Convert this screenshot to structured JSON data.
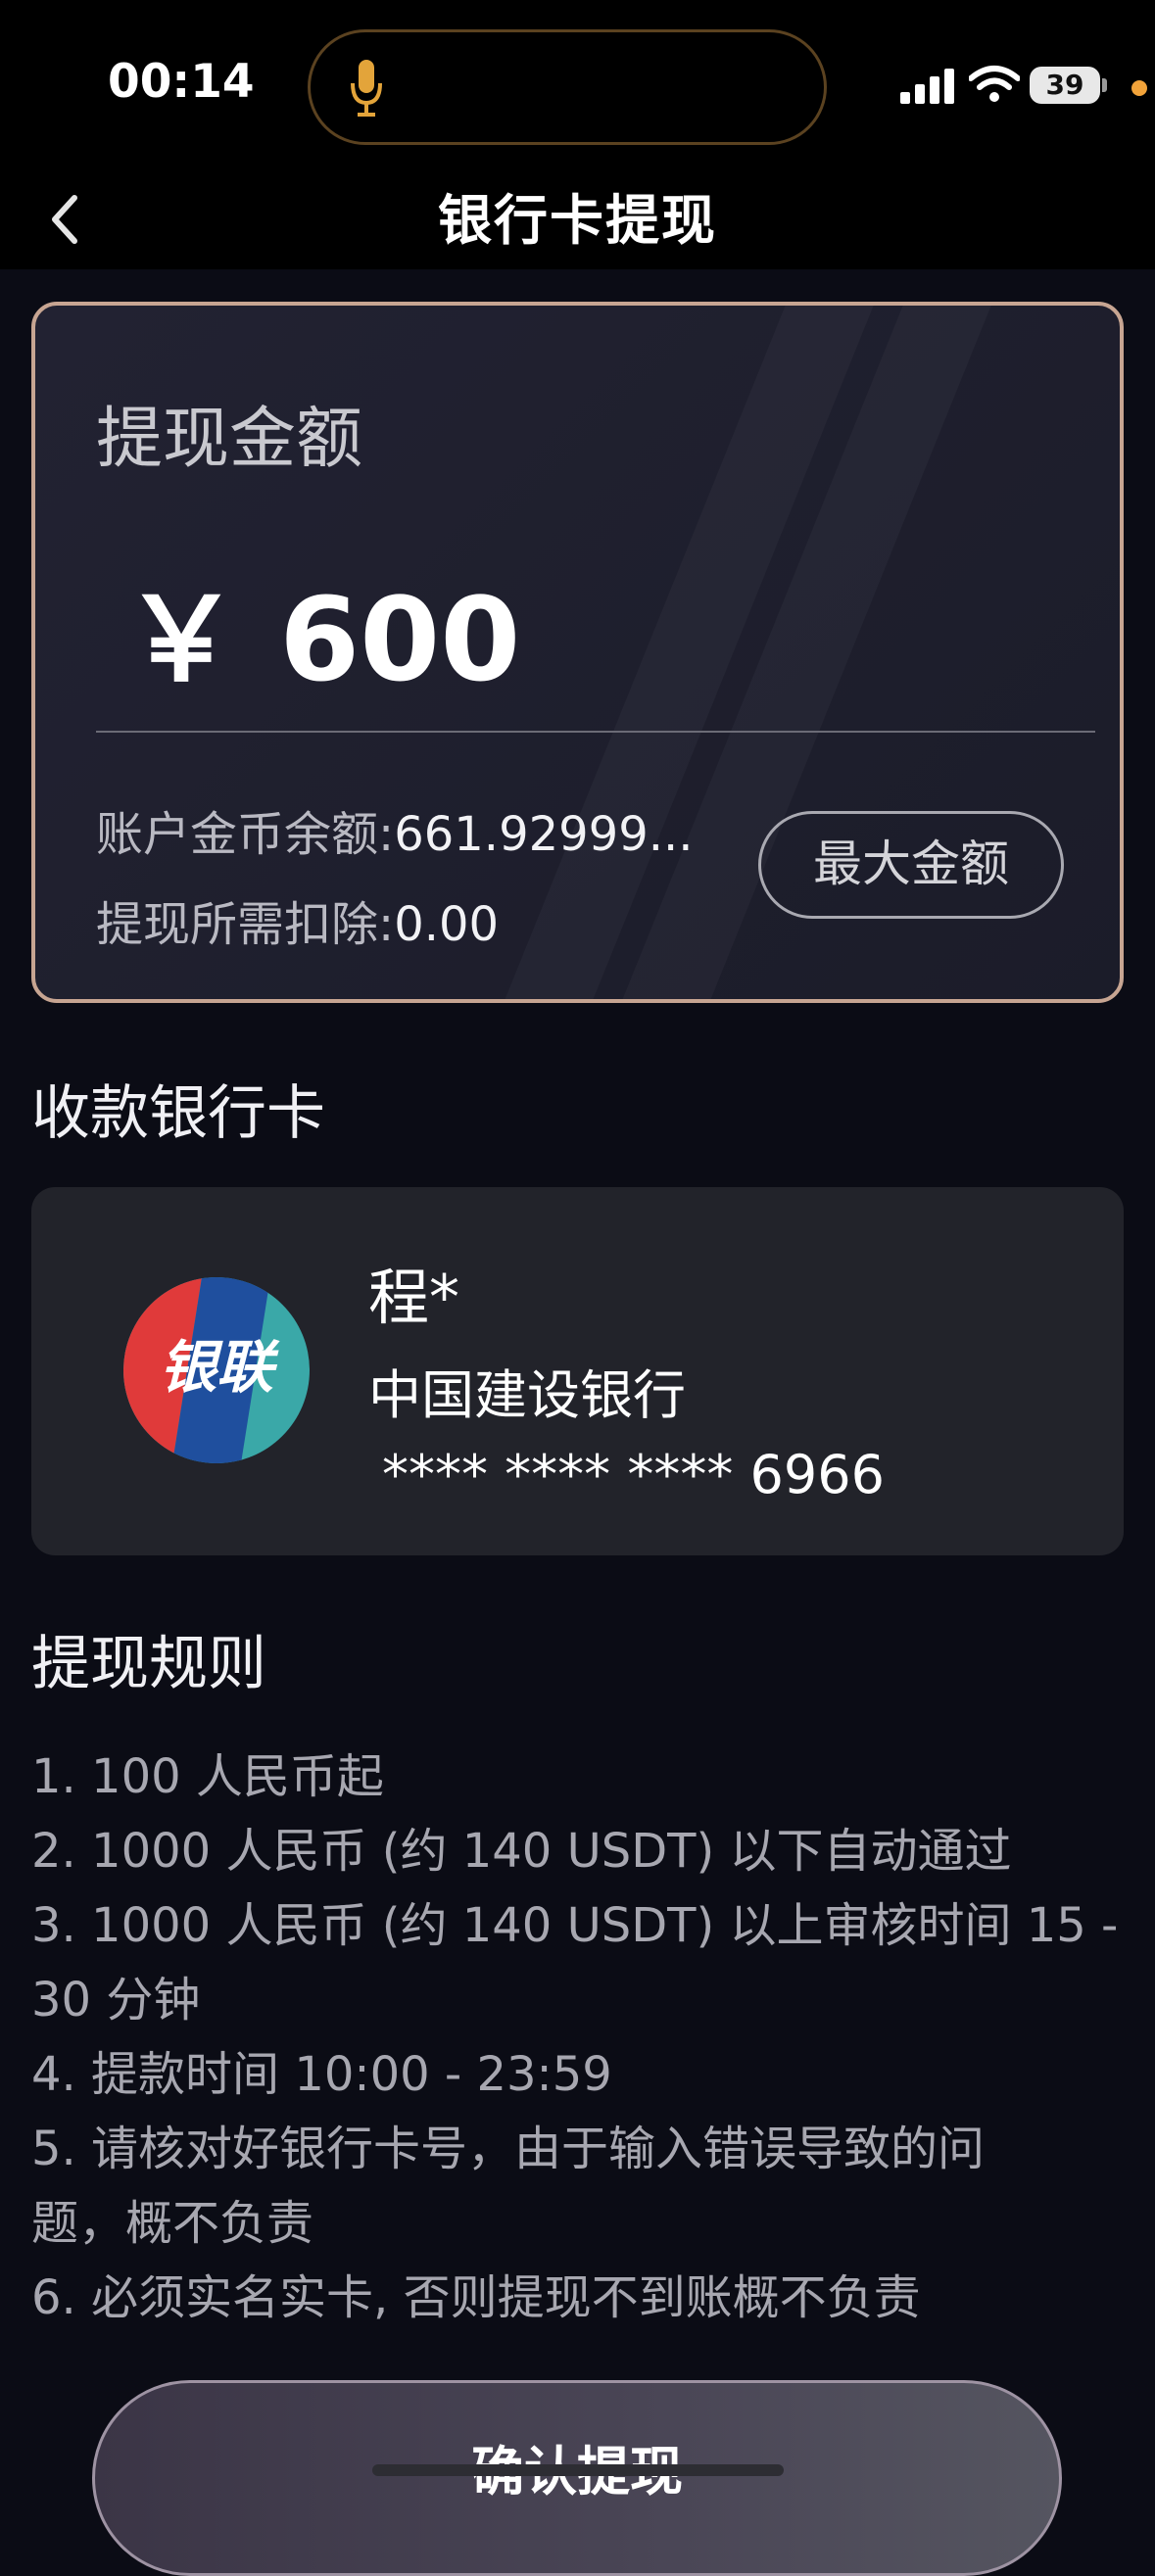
{
  "status_bar": {
    "time": "00:14",
    "battery": "39",
    "icons": [
      "mic-icon",
      "signal-icon",
      "wifi-icon",
      "battery-icon"
    ]
  },
  "nav": {
    "title": "银行卡提现",
    "back_icon": "chevron-left-icon"
  },
  "withdraw": {
    "label": "提现金额",
    "amount": "￥ 600",
    "balance_label": "账户金币余额:",
    "balance_value": "661.92999...",
    "fee_label": "提现所需扣除:",
    "fee_value": "0.00",
    "max_button": "最大金额"
  },
  "bank_section": {
    "title": "收款银行卡",
    "holder": "程*",
    "bank": "中国建设银行",
    "card_number": " **** **** **** 6966",
    "logo_text": "银联"
  },
  "rules": {
    "title": "提现规则",
    "lines": [
      "1. 100 人民币起",
      "2. 1000 人民币 (约 140 USDT) 以下自动通过",
      "3. 1000 人民币 (约 140 USDT) 以上审核时间 15 -",
      "30 分钟",
      "4. 提款时间 10:00 - 23:59",
      "5. 请核对好银行卡号，由于输入错误导致的问",
      "题，概不负责",
      "6. 必须实名实卡, 否则提现不到账概不负责"
    ]
  },
  "confirm_button": "确认提现",
  "colors": {
    "background": "#0b0c15",
    "card_border": "#c7a592",
    "island_border": "#5b4220",
    "unionpay_red": "#e03a3a",
    "unionpay_blue": "#1f4f9e",
    "unionpay_teal": "#3aa8a8"
  }
}
